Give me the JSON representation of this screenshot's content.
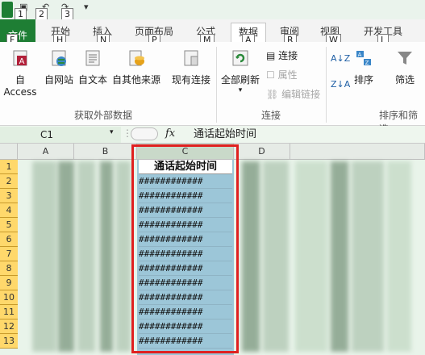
{
  "qat": {
    "keytips": [
      "1",
      "2",
      "3"
    ]
  },
  "tabs": [
    {
      "label": "文件",
      "key": "F"
    },
    {
      "label": "开始",
      "key": "H"
    },
    {
      "label": "插入",
      "key": "N"
    },
    {
      "label": "页面布局",
      "key": "P"
    },
    {
      "label": "公式",
      "key": "M"
    },
    {
      "label": "数据",
      "key": "A"
    },
    {
      "label": "审阅",
      "key": "R"
    },
    {
      "label": "视图",
      "key": "W"
    },
    {
      "label": "开发工具",
      "key": "L"
    }
  ],
  "ribbon": {
    "get_external": {
      "access": "自 Access",
      "web": "自网站",
      "text": "自文本",
      "other": "自其他来源",
      "existing": "现有连接",
      "group_label": "获取外部数据"
    },
    "connections": {
      "refresh_all": "全部刷新",
      "connections": "连接",
      "properties": "属性",
      "edit_links": "编辑链接",
      "group_label": "连接"
    },
    "sort_filter": {
      "sort": "排序",
      "filter": "筛选",
      "group_label": "排序和筛选"
    }
  },
  "formula_bar": {
    "name_box": "C1",
    "fx": "fx",
    "content": "通话起始时间"
  },
  "grid": {
    "columns": [
      "A",
      "B",
      "C",
      "D"
    ],
    "rows": [
      "1",
      "2",
      "3",
      "4",
      "5",
      "6",
      "7",
      "8",
      "9",
      "10",
      "11",
      "12",
      "13"
    ],
    "c1": "通话起始时间",
    "hash": "############"
  },
  "colors": {
    "excel_green": "#1e7e34",
    "row_header": "#ffd86b",
    "selection": "#9cc6d8",
    "highlight_border": "#e02020"
  }
}
